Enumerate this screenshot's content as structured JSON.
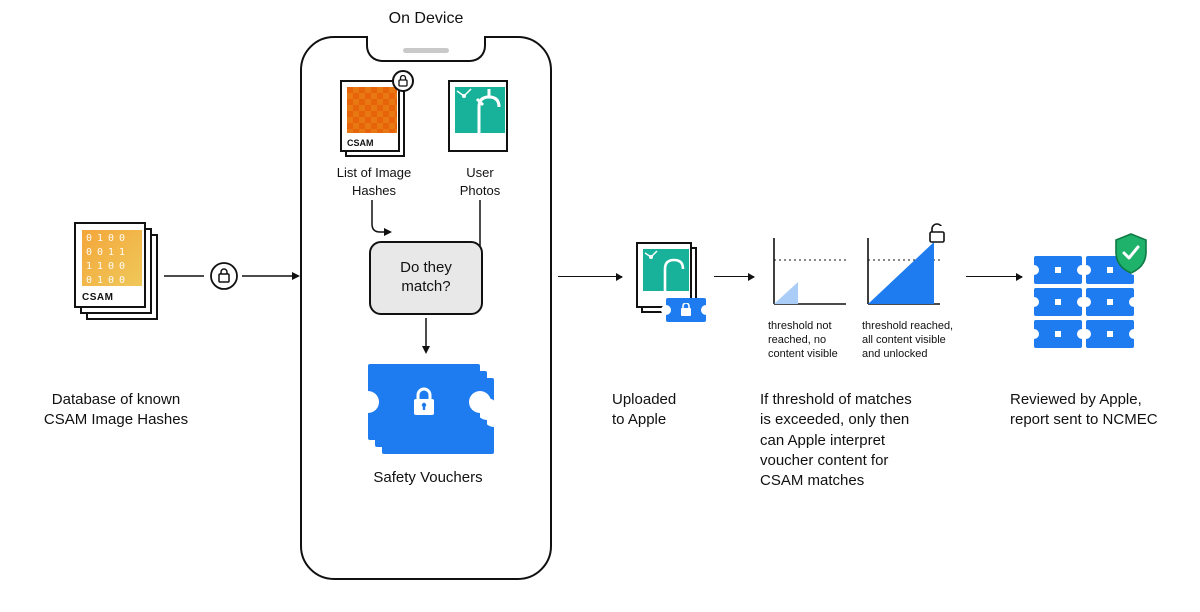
{
  "title_on_device": "On Device",
  "database": {
    "csam_binary": "0100\n0011\n1100\n0100",
    "tag": "CSAM",
    "caption": "Database of known\nCSAM Image Hashes"
  },
  "on_device": {
    "hash_tile_tag": "CSAM",
    "hash_tile_caption": "List of Image\nHashes",
    "user_tile_caption": "User\nPhotos",
    "match_question": "Do they\nmatch?",
    "vouchers_caption": "Safety Vouchers"
  },
  "upload": {
    "caption": "Uploaded\nto Apple"
  },
  "threshold": {
    "left_label": "threshold not\nreached, no\ncontent visible",
    "right_label": "threshold reached,\nall content visible\nand unlocked",
    "caption": "If threshold of matches\nis exceeded, only then\ncan Apple interpret\nvoucher content for\nCSAM matches"
  },
  "review": {
    "caption": "Reviewed by Apple,\nreport sent to NCMEC"
  },
  "colors": {
    "blue": "#1f7cf0",
    "blue_light": "#a9cdf7",
    "orange": "#f4a63a",
    "teal": "#18b29a",
    "shield": "#1fb26a",
    "ink": "#111111"
  }
}
